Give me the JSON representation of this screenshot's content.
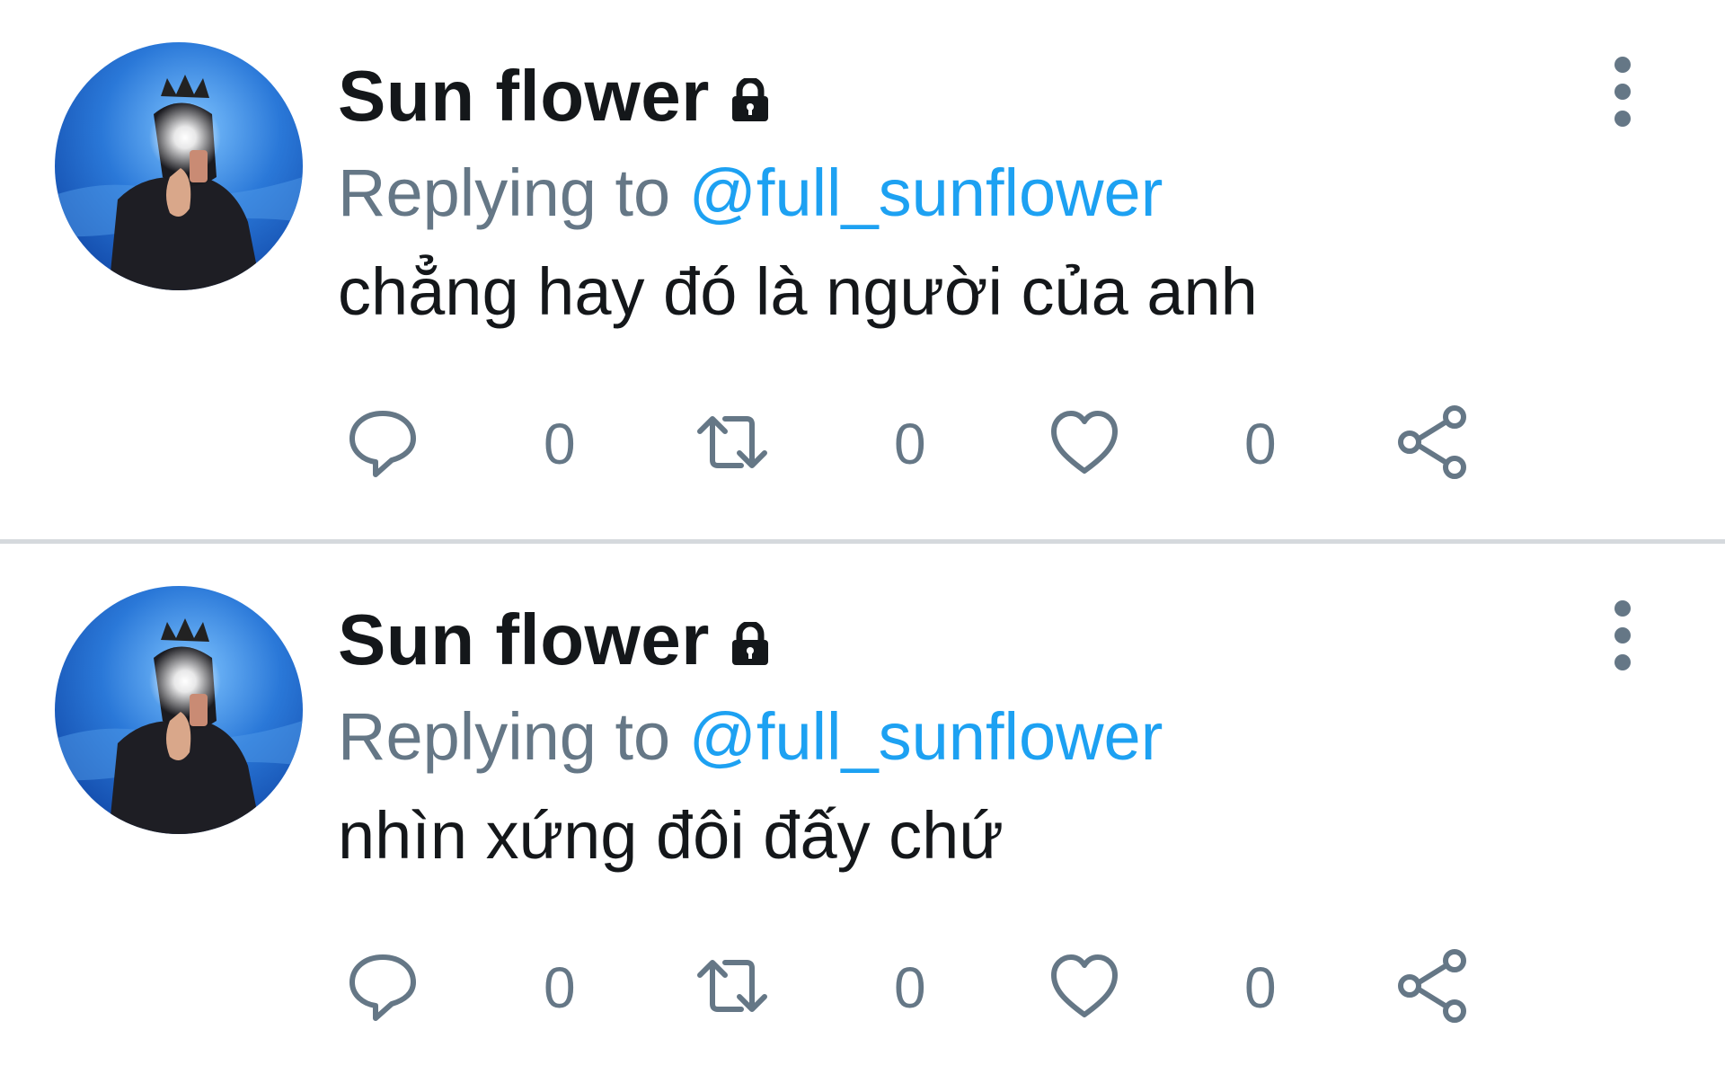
{
  "colors": {
    "name": "#14171a",
    "secondary": "#657786",
    "link": "#1da1f2",
    "icon": "#657786",
    "divider": "#d5d9dd"
  },
  "tweets": [
    {
      "display_name": "Sun flower",
      "replying_label": "Replying to",
      "reply_handle": "@full_sunflower",
      "text": "chẳng hay đó là người của anh",
      "reply_count": "0",
      "retweet_count": "0",
      "like_count": "0",
      "icons": [
        "lock-icon",
        "more-vertical-icon",
        "reply-icon",
        "retweet-icon",
        "heart-icon",
        "share-icon"
      ]
    },
    {
      "display_name": "Sun flower",
      "replying_label": "Replying to",
      "reply_handle": "@full_sunflower",
      "text": "nhìn xứng đôi đấy chứ",
      "reply_count": "0",
      "retweet_count": "0",
      "like_count": "0",
      "icons": [
        "lock-icon",
        "more-vertical-icon",
        "reply-icon",
        "retweet-icon",
        "heart-icon",
        "share-icon"
      ]
    }
  ]
}
